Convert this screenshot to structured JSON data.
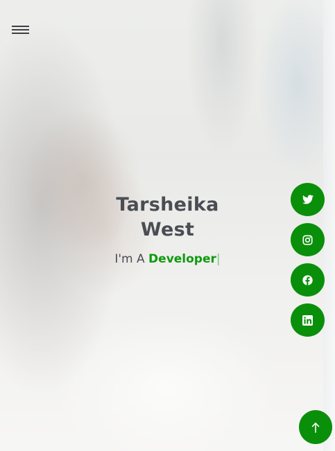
{
  "hero": {
    "first_name": "Tarsheika",
    "last_name": "West",
    "typed_prefix": "I'm A",
    "typed_word": "Developer",
    "typed_cursor": "|"
  },
  "nav": {
    "menu_icon": "hamburger-menu-icon"
  },
  "social_links": [
    {
      "icon": "twitter-icon"
    },
    {
      "icon": "instagram-icon"
    },
    {
      "icon": "facebook-icon"
    },
    {
      "icon": "linkedin-icon"
    }
  ],
  "back_to_top": {
    "icon": "arrow-up-icon"
  },
  "colors": {
    "accent": "#0a8f0a",
    "accent_text": "#0e9a0e",
    "heading_text": "#4a4d52"
  }
}
